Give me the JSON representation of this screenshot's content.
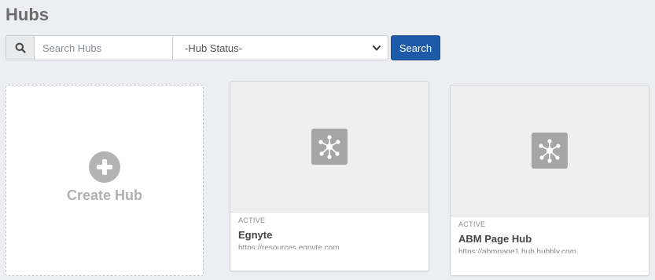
{
  "page": {
    "title": "Hubs"
  },
  "toolbar": {
    "search_placeholder": "Search Hubs",
    "search_value": "",
    "status_selected": "-Hub Status-",
    "search_button_label": "Search"
  },
  "create_card": {
    "label": "Create Hub"
  },
  "hubs": [
    {
      "status": "ACTIVE",
      "name": "Egnyte",
      "url": "https://resources.egnyte.com"
    },
    {
      "status": "ACTIVE",
      "name": "ABM Page Hub",
      "url": "https://abmpage1.hub.hubbly.com"
    }
  ],
  "colors": {
    "primary_button": "#1d5aa8",
    "background": "#eceef2",
    "logo_tile": "#a6a6a6"
  }
}
